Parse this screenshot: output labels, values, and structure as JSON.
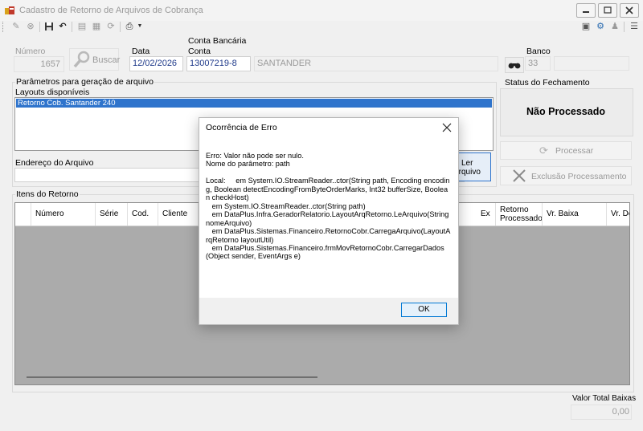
{
  "window": {
    "title": "Cadastro de Retorno de Arquivos de Cobrança"
  },
  "header": {
    "numero_label": "Número",
    "numero_value": "1657",
    "buscar_label": "Buscar",
    "data_label": "Data",
    "data_value": "12/02/2026",
    "conta_bancaria_label": "Conta Bancária",
    "conta_label": "Conta",
    "conta_value": "13007219-8",
    "conta_name": "SANTANDER",
    "banco_label": "Banco",
    "banco_value": "33"
  },
  "parametros": {
    "title": "Parâmetros para geração de arquivo",
    "layouts_label": "Layouts disponíveis",
    "layouts": [
      "Retorno Cob. Santander 240"
    ],
    "endereco_label": "Endereço do Arquivo",
    "endereco_value": "",
    "ler_arquivo_line1": "Ler",
    "ler_arquivo_line2": "Arquivo"
  },
  "status": {
    "title": "Status do Fechamento",
    "value": "Não Processado",
    "processar_label": "Processar",
    "exclusao_label": "Exclusão Processamento"
  },
  "itens": {
    "title": "Itens do Retorno",
    "columns": [
      "Número",
      "Série",
      "Cod.",
      "Cliente",
      "Ex",
      "Retorno Processado",
      "Vr. Baixa",
      "Vr. De"
    ]
  },
  "footer": {
    "total_label": "Valor Total Baixas",
    "total_value": "0,00"
  },
  "dialog": {
    "title": "Ocorrência de Erro",
    "message": "Erro: Valor não pode ser nulo.\nNome do parâmetro: path\n\nLocal:     em System.IO.StreamReader..ctor(String path, Encoding encoding, Boolean detectEncodingFromByteOrderMarks, Int32 bufferSize, Boolean checkHost)\n   em System.IO.StreamReader..ctor(String path)\n   em DataPlus.Infra.GeradorRelatorio.LayoutArqRetorno.LeArquivo(String nomeArquivo)\n   em DataPlus.Sistemas.Financeiro.RetornoCobr.CarregaArquivo(LayoutArqRetorno layoutUtil)\n   em DataPlus.Sistemas.Financeiro.frmMovRetornoCobr.CarregarDados(Object sender, EventArgs e)",
    "ok_label": "OK"
  }
}
